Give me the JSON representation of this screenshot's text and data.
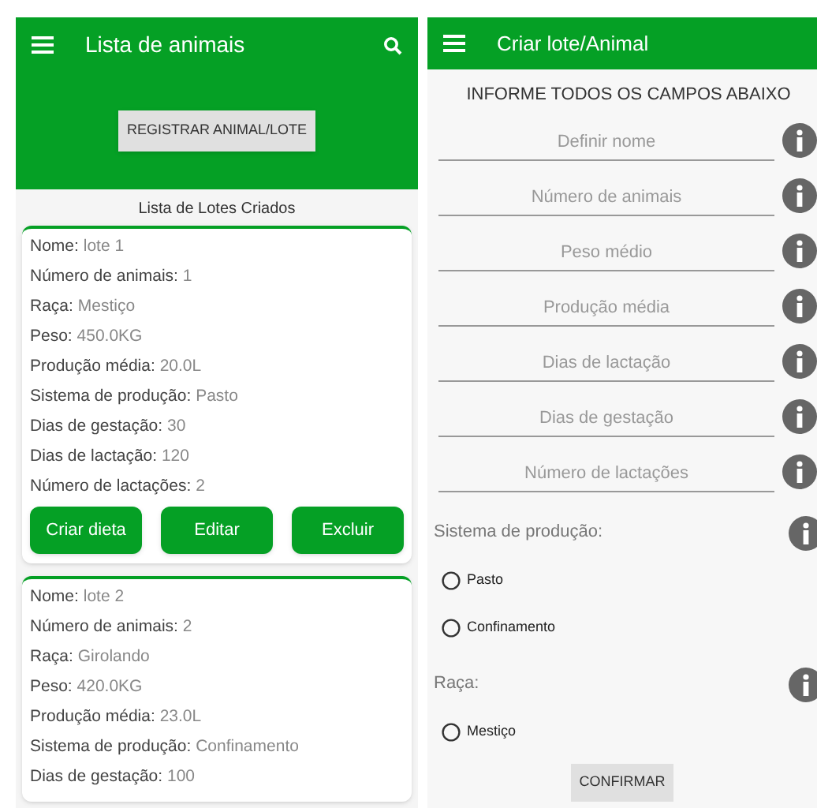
{
  "list_screen": {
    "title": "Lista de animais",
    "register_button": "REGISTRAR ANIMAL/LOTE",
    "list_heading": "Lista de Lotes Criados",
    "lots": [
      {
        "fields": [
          {
            "label": "Nome:",
            "value": "lote 1"
          },
          {
            "label": "Número de animais:",
            "value": "1"
          },
          {
            "label": "Raça:",
            "value": "Mestiço"
          },
          {
            "label": "Peso:",
            "value": "450.0KG"
          },
          {
            "label": "Produção média:",
            "value": "20.0L"
          },
          {
            "label": "Sistema de produção:",
            "value": "Pasto"
          },
          {
            "label": "Dias de gestação:",
            "value": "30"
          },
          {
            "label": "Dias de lactação:",
            "value": "120"
          },
          {
            "label": "Número de lactações:",
            "value": "2"
          }
        ],
        "actions": [
          "Criar dieta",
          "Editar",
          "Excluir"
        ]
      },
      {
        "fields": [
          {
            "label": "Nome:",
            "value": "lote 2"
          },
          {
            "label": "Número de animais:",
            "value": "2"
          },
          {
            "label": "Raça:",
            "value": "Girolando"
          },
          {
            "label": "Peso:",
            "value": "420.0KG"
          },
          {
            "label": "Produção média:",
            "value": "23.0L"
          },
          {
            "label": "Sistema de produção:",
            "value": "Confinamento"
          },
          {
            "label": "Dias de gestação:",
            "value": "100"
          }
        ]
      }
    ]
  },
  "form_screen": {
    "title": "Criar lote/Animal",
    "heading": "INFORME TODOS OS CAMPOS ABAIXO",
    "fields": [
      {
        "placeholder": "Definir nome"
      },
      {
        "placeholder": "Número de animais"
      },
      {
        "placeholder": "Peso médio"
      },
      {
        "placeholder": "Produção média"
      },
      {
        "placeholder": "Dias de lactação"
      },
      {
        "placeholder": "Dias de gestação"
      },
      {
        "placeholder": "Número de lactações"
      }
    ],
    "groups": [
      {
        "label": "Sistema de produção:",
        "options": [
          {
            "label": "Pasto",
            "selected": false
          },
          {
            "label": "Confinamento",
            "selected": false
          }
        ]
      },
      {
        "label": "Raça:",
        "options": [
          {
            "label": "Mestiço",
            "selected": false
          }
        ]
      }
    ],
    "confirm_button": "CONFIRMAR"
  }
}
